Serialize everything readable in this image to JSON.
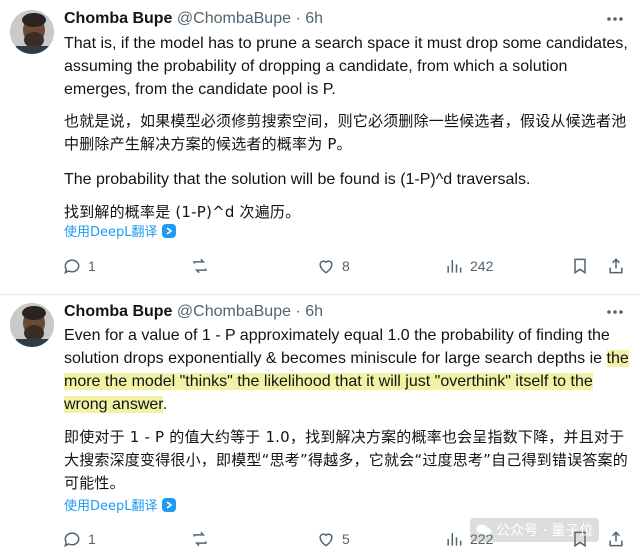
{
  "tweets": [
    {
      "author_name": "Chomba Bupe",
      "handle": "@ChombaBupe",
      "separator": "·",
      "time": "6h",
      "paragraphs": [
        "That is, if the model has to prune a search space it must drop some candidates, assuming the probability of dropping a candidate, from which a solution emerges, from the candidate pool is P.",
        "也就是说，如果模型必须修剪搜索空间，则它必须删除一些候选者，假设从候选者池中删除产生解决方案的候选者的概率为 P。",
        "The probability that the solution will be found is (1-P)^d traversals.",
        "找到解的概率是 (1-P)^d 次遍历。"
      ],
      "translate_label": "使用DeepL翻译",
      "replies": "1",
      "reposts": "",
      "likes": "8",
      "views": "242"
    },
    {
      "author_name": "Chomba Bupe",
      "handle": "@ChombaBupe",
      "separator": "·",
      "time": "6h",
      "para1_plain": "Even for a value of 1 - P approximately equal 1.0 the probability of finding the solution drops exponentially & becomes miniscule for large search depths ie ",
      "para1_highlight": "the more the model \"thinks\" the likelihood that it will just \"overthink\" itself to the wrong answer",
      "para1_end": ".",
      "para2": "即使对于 1 - P 的值大约等于 1.0，找到解决方案的概率也会呈指数下降，并且对于大搜索深度变得很小，即模型“思考”得越多，它就会“过度思考”自己得到错误答案的可能性。",
      "translate_label": "使用DeepL翻译",
      "replies": "1",
      "reposts": "",
      "likes": "5",
      "views": "222"
    }
  ],
  "watermark": "公众号 · 量子位",
  "colors": {
    "accent": "#1d9bf0",
    "highlight": "#f3f2a4",
    "muted": "#536471"
  }
}
